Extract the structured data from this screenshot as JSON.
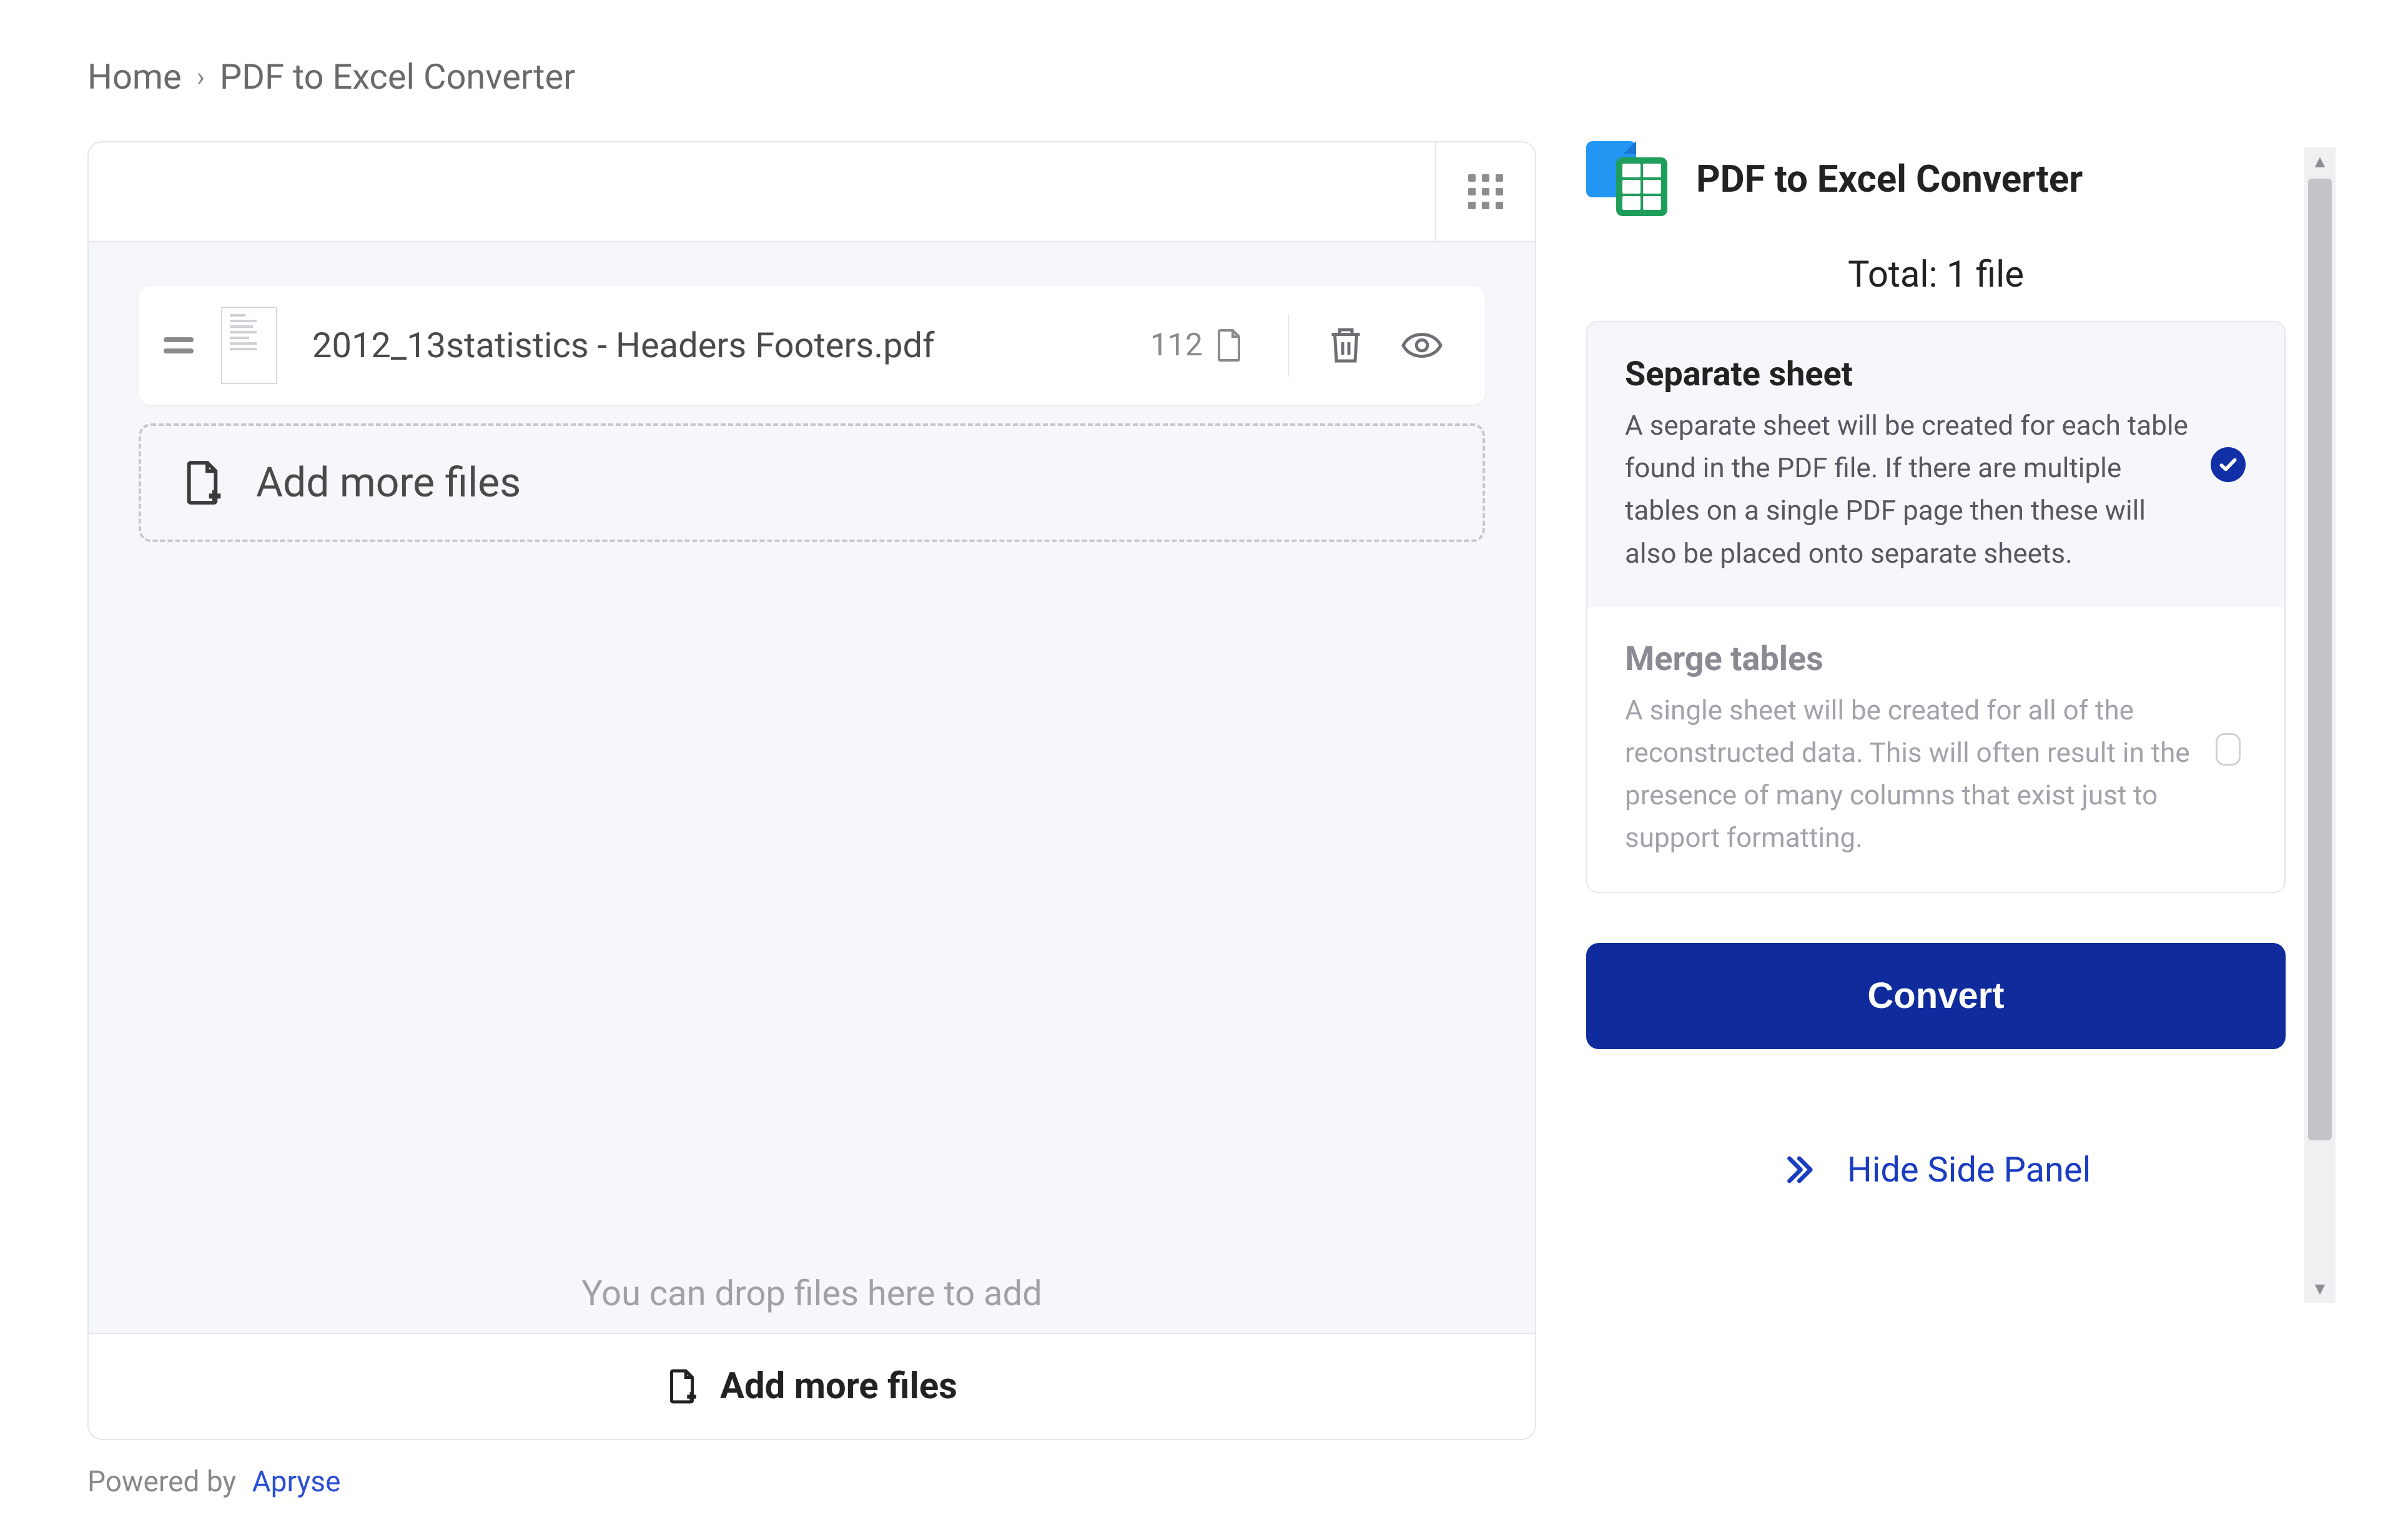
{
  "breadcrumb": {
    "home": "Home",
    "current": "PDF to Excel Converter"
  },
  "file_list": {
    "files": [
      {
        "name": "2012_13statistics - Headers Footers.pdf",
        "pages": "112"
      }
    ],
    "add_more_label": "Add more files",
    "drop_hint": "You can drop files here to add"
  },
  "footer_add_label": "Add more files",
  "powered_by": {
    "prefix": "Powered by",
    "vendor": "Apryse"
  },
  "side_panel": {
    "title": "PDF to Excel Converter",
    "total_label": "Total: 1 file",
    "options": [
      {
        "title": "Separate sheet",
        "desc": "A separate sheet will be created for each table found in the PDF file. If there are multiple tables on a single PDF page then these will also be placed onto separate sheets.",
        "selected": true
      },
      {
        "title": "Merge tables",
        "desc": "A single sheet will be created for all of the reconstructed data. This will often result in the presence of many columns that exist just to support formatting.",
        "selected": false
      }
    ],
    "convert_label": "Convert",
    "hide_label": "Hide Side Panel"
  }
}
